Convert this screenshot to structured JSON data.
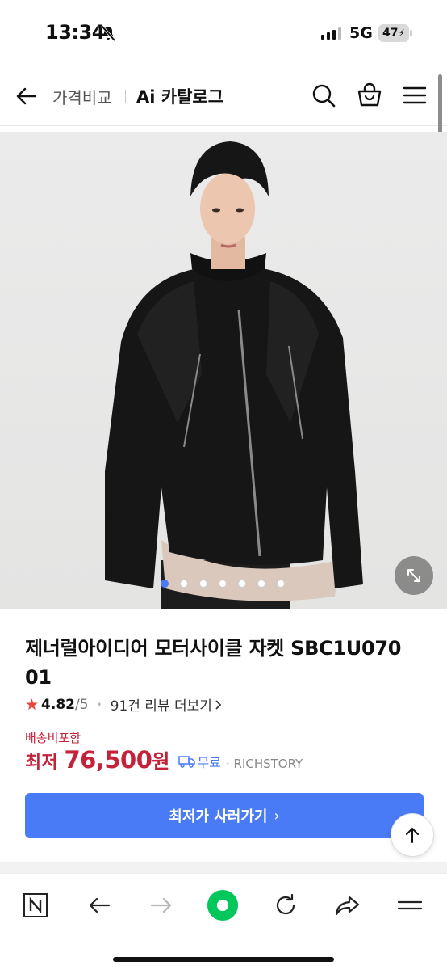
{
  "status_bar": {
    "time": "13:34",
    "network": "5G",
    "battery": "47"
  },
  "header": {
    "breadcrumb": "가격비교",
    "title": "Ai 카탈로그"
  },
  "gallery": {
    "image_count": 7,
    "active_index": 0
  },
  "product": {
    "name": "제너럴아이디어 모터사이클 자켓 SBC1U070 01",
    "rating": "4.82",
    "rating_max": "/5",
    "reviews": "91건 리뷰 더보기",
    "shipping_included": "배송비포함",
    "price_label": "최저",
    "price": "76,500",
    "currency": "원",
    "delivery": "무료",
    "seller": "RICHSTORY"
  },
  "actions": {
    "buy_button": "최저가 사러가기"
  },
  "colors": {
    "accent_blue": "#4a7bf7",
    "price_red": "#c4213a",
    "star": "#e8453c",
    "browser_green": "#03c75a"
  },
  "icons": {
    "back": "arrow-left-icon",
    "search": "search-icon",
    "cart": "shopping-bag-icon",
    "menu": "hamburger-icon",
    "expand": "expand-icon",
    "scroll_top": "arrow-up-icon"
  }
}
